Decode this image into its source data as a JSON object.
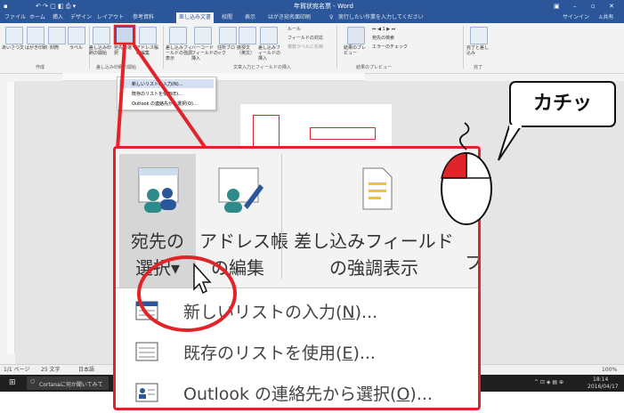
{
  "window": {
    "title": "年賀状宛名票 - Word",
    "tell_me": "実行したい作業を入力してください",
    "signin": "サインイン",
    "share": "共有"
  },
  "tabs": [
    "ファイル",
    "ホーム",
    "挿入",
    "デザイン",
    "レイアウト",
    "参考資料",
    "差し込み文書",
    "校閲",
    "表示",
    "はがき宛名面印刷"
  ],
  "ribbon": {
    "buttons": [
      "あいさつ文",
      "はがき印刷",
      "封筒",
      "ラベル",
      "差し込み印刷の開始",
      "宛先の選択",
      "アドレス帳の編集",
      "差し込みフィールドの強調表示",
      "バーコードフィールドの挿入",
      "住所ブロック",
      "挨拶文（英文）",
      "差し込みフィールドの挿入",
      "結果のプレビュー",
      "完了と差し込み"
    ],
    "small_items": [
      "ルール",
      "フィールドの対応",
      "複数ラベルに反映",
      "宛先の検索",
      "エラーのチェック"
    ],
    "record": "1",
    "groups": [
      "作成",
      "差し込み印刷の開始",
      "文章入力とフィールドの挿入",
      "結果のプレビュー",
      "完了"
    ]
  },
  "small_dropdown": [
    "新しいリストの入力(N)...",
    "既存のリストを使用(E)...",
    "Outlook の連絡先から選択(O)..."
  ],
  "zoom": {
    "buttons": [
      {
        "line1": "宛先の",
        "line2": "選択▾"
      },
      {
        "line1": "アドレス帳",
        "line2": "の編集"
      },
      {
        "line1": "差し込みフィールド",
        "line2": "の強調表示"
      }
    ],
    "menu": [
      {
        "label": "新しいリストの入力(",
        "key": "N",
        "tail": ")..."
      },
      {
        "label": "既存のリストを使用(",
        "key": "E",
        "tail": ")..."
      },
      {
        "label": "Outlook の連絡先から選択(",
        "key": "O",
        "tail": ")..."
      }
    ]
  },
  "callout": "カチッ",
  "status": {
    "page": "1/1 ページ",
    "words": "25 文字",
    "lang": "日本語",
    "zoom": "100%"
  },
  "taskbar": {
    "search": "Cortanaに何か聞いてみて",
    "time": "18:14",
    "date": "2016/04/17"
  },
  "colors": {
    "word_blue": "#2b579a",
    "highlight_red": "#e0242a"
  }
}
